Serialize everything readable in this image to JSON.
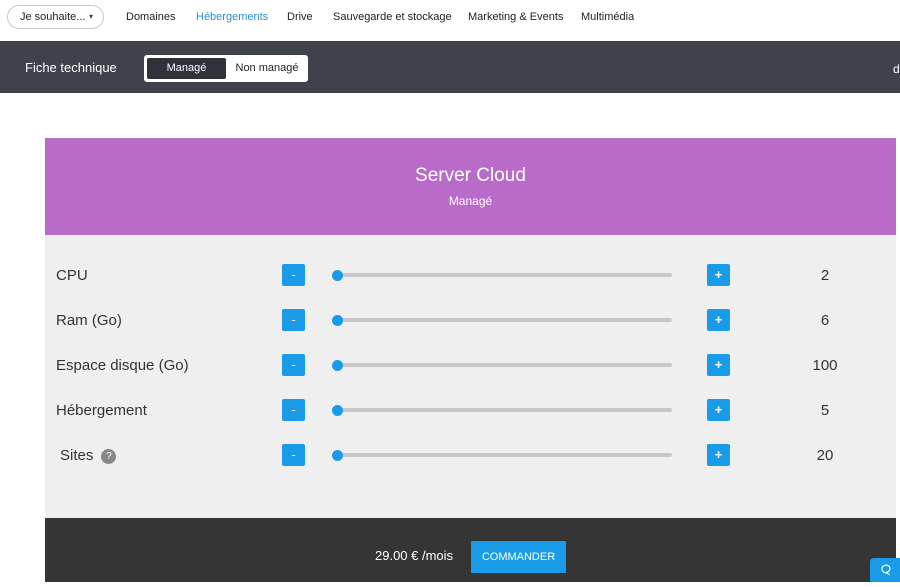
{
  "nav": {
    "dropdown_label": "Je souhaite...",
    "links": [
      "Domaines",
      "Hébergements",
      "Drive",
      "Sauvegarde et stockage",
      "Marketing & Events",
      "Multimédia"
    ],
    "active_index": 1
  },
  "subnav": {
    "title": "Fiche technique",
    "toggle_on": "Managé",
    "toggle_off": "Non managé",
    "edge_text": "d"
  },
  "product": {
    "name": "Server Cloud",
    "subtitle": "Managé"
  },
  "config": {
    "minus_label": "-",
    "plus_label": "+",
    "help_label": "?",
    "rows": [
      {
        "label": "CPU",
        "value": "2",
        "slider_fraction": 0
      },
      {
        "label": "Ram (Go)",
        "value": "6",
        "slider_fraction": 0
      },
      {
        "label": "Espace disque (Go)",
        "value": "100",
        "slider_fraction": 0
      },
      {
        "label": "Hébergement",
        "value": "5",
        "slider_fraction": 0
      },
      {
        "label": "Sites",
        "value": "20",
        "slider_fraction": 0
      }
    ]
  },
  "footer": {
    "price": "29.00 € /mois",
    "order_label": "COMMANDER"
  },
  "colors": {
    "accent": "#1a9be8",
    "header_purple": "#b86bc8",
    "subbar": "#3f424b",
    "active_link": "#2b8fd1"
  },
  "icons": {
    "dropdown": "chevron-down-icon",
    "help": "question-icon",
    "chat": "chat-bubble-icon"
  }
}
